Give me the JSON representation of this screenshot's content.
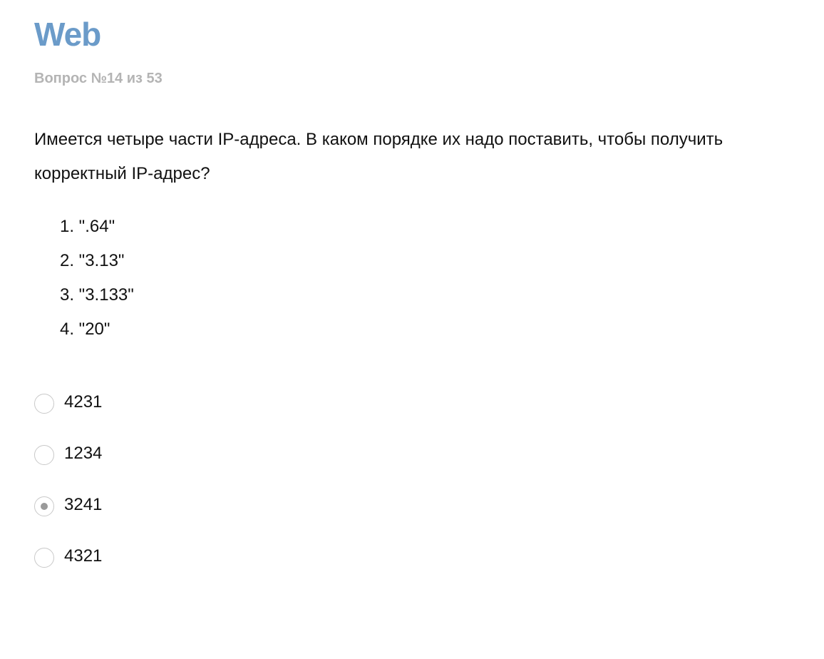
{
  "header": {
    "title": "Web",
    "counter": "Вопрос №14 из 53"
  },
  "question": {
    "text": "Имеется четыре части IP-адреса. В каком порядке их надо поставить, чтобы получить корректный IP-адрес?",
    "parts": [
      "1. \".64\"",
      "2. \"3.13\"",
      "3. \"3.133\"",
      "4. \"20\""
    ]
  },
  "answers": {
    "selected_index": 2,
    "options": [
      {
        "label": "4231",
        "selected": false
      },
      {
        "label": "1234",
        "selected": false
      },
      {
        "label": "3241",
        "selected": true
      },
      {
        "label": "4321",
        "selected": false
      }
    ]
  },
  "colors": {
    "title": "#6b9bc9",
    "counter": "#b4b4b4",
    "radio_border": "#c9c9c9",
    "radio_dot": "#9a9a9a"
  }
}
